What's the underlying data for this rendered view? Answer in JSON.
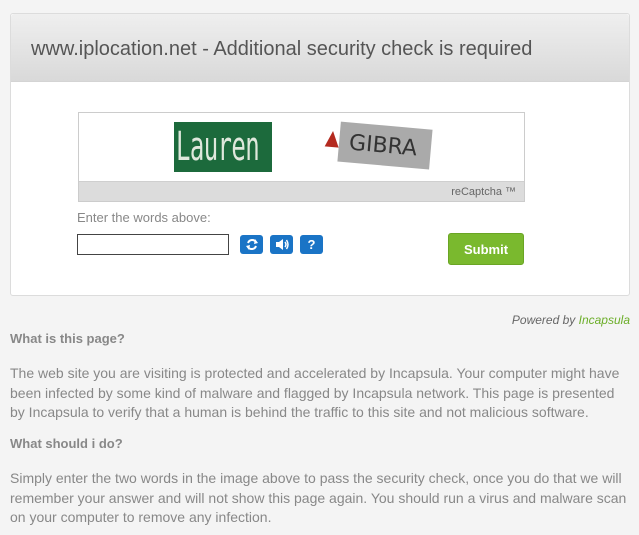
{
  "header": {
    "title": "www.iplocation.net - Additional security check is required"
  },
  "captcha": {
    "word_left": "Lauren",
    "word_right": "GIBRA",
    "brand_label": "reCaptcha ™",
    "instruction": "Enter the words above:",
    "input_value": "",
    "refresh_icon": "refresh-icon",
    "audio_icon": "audio-icon",
    "help_icon": "help-icon",
    "help_glyph": "?",
    "submit_label": "Submit"
  },
  "footer": {
    "powered_by": "Powered by",
    "brand": "Incapsula"
  },
  "info": {
    "q1": "What is this page?",
    "a1": "The web site you are visiting is protected and accelerated by Incapsula. Your computer might have been infected by some kind of malware and flagged by Incapsula network. This page is presented by Incapsula to verify that a human is behind the traffic to this site and not malicious software.",
    "q2": "What should i do?",
    "a2": "Simply enter the two words in the image above to pass the security check, once you do that we will remember your answer and will not show this page again. You should run a virus and malware scan on your computer to remove any infection."
  },
  "colors": {
    "accent_blue": "#1a74c6",
    "submit_green": "#7ab92e",
    "brand_green": "#6cae29"
  }
}
